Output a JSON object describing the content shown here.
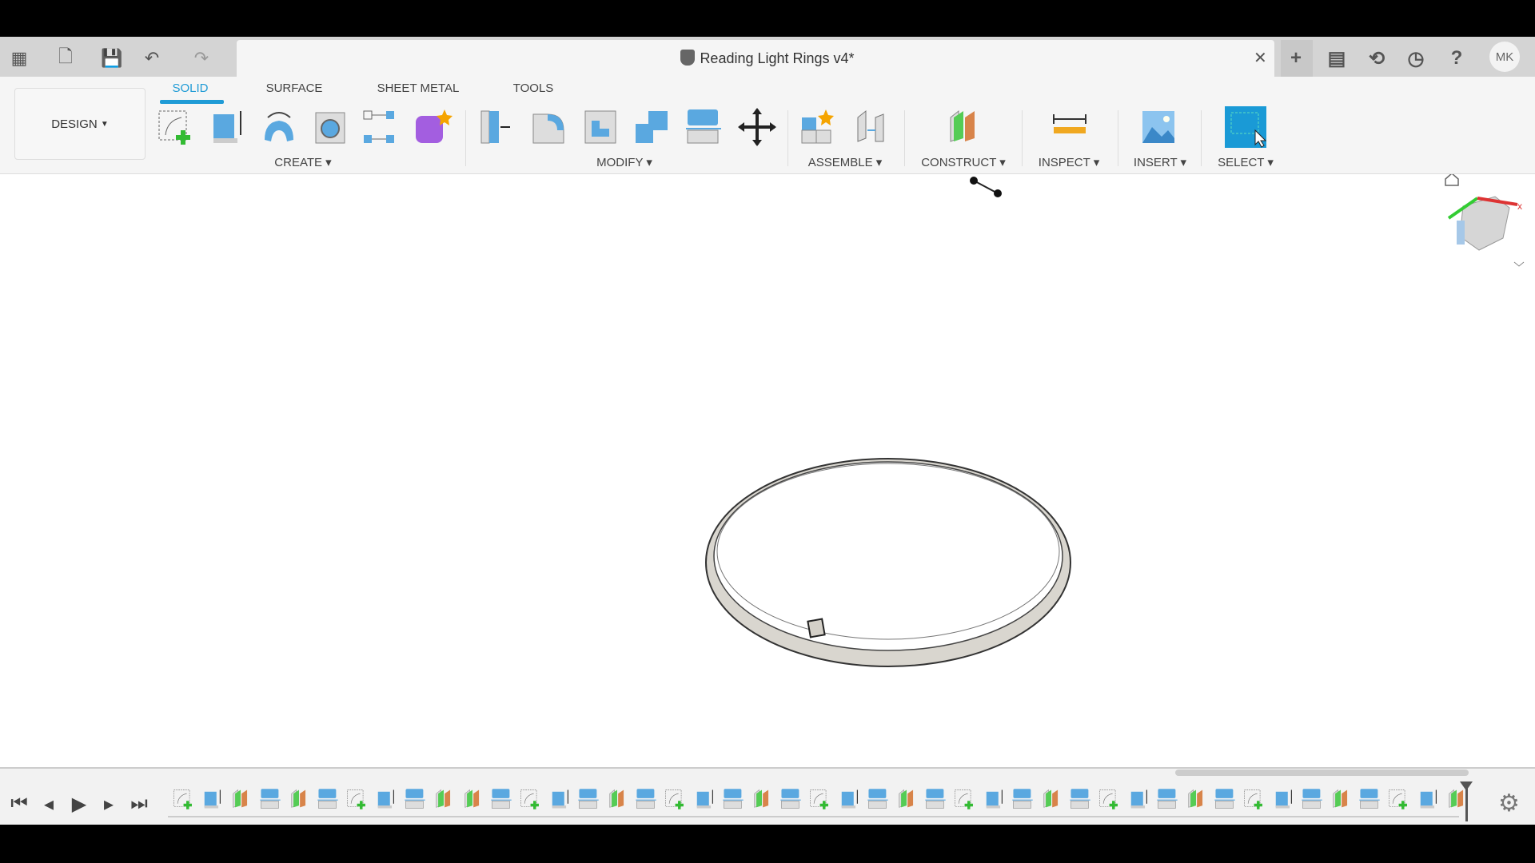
{
  "window": {
    "title": "Reading Light Rings v4*",
    "user_initials": "MK"
  },
  "quick_access": [
    "grid-icon",
    "file-icon",
    "save-icon",
    "undo-icon",
    "redo-icon"
  ],
  "workspace": {
    "label": "DESIGN"
  },
  "tabs": [
    {
      "label": "SOLID",
      "active": true
    },
    {
      "label": "SURFACE"
    },
    {
      "label": "SHEET METAL"
    },
    {
      "label": "TOOLS"
    }
  ],
  "groups": [
    {
      "label": "CREATE ▾",
      "tools": [
        "create-sketch",
        "extrude",
        "revolve",
        "hole",
        "pattern",
        "create-form"
      ]
    },
    {
      "label": "MODIFY ▾",
      "tools": [
        "press-pull",
        "fillet",
        "shell",
        "combine",
        "split-body",
        "move"
      ]
    },
    {
      "label": "ASSEMBLE ▾",
      "tools": [
        "new-component",
        "joint"
      ]
    },
    {
      "label": "CONSTRUCT ▾",
      "tools": [
        "offset-plane"
      ]
    },
    {
      "label": "INSPECT ▾",
      "tools": [
        "measure"
      ]
    },
    {
      "label": "INSERT ▾",
      "tools": [
        "insert-canvas"
      ]
    },
    {
      "label": "SELECT ▾",
      "tools": [
        "select"
      ]
    }
  ],
  "right_icons": [
    "add-tab-icon",
    "comments-icon",
    "extensions-icon",
    "job-status-icon",
    "help-icon"
  ],
  "timeline": {
    "controls": [
      "skip-to-start",
      "step-back",
      "play",
      "step-forward",
      "skip-to-end"
    ],
    "items": [
      "sketch",
      "extrude",
      "plane",
      "split",
      "plane",
      "split",
      "sketch",
      "extrude",
      "split",
      "plane",
      "plane",
      "split",
      "sketch",
      "extrude",
      "split",
      "plane",
      "split",
      "sketch",
      "extrude",
      "split",
      "plane",
      "split",
      "sketch",
      "extrude",
      "split",
      "plane",
      "split",
      "sketch",
      "extrude",
      "split",
      "plane",
      "split",
      "sketch",
      "extrude",
      "split",
      "plane",
      "split",
      "sketch",
      "extrude",
      "split",
      "plane",
      "split",
      "sketch",
      "extrude",
      "plane"
    ]
  },
  "colors": {
    "accent": "#1f9bd6",
    "select_active": "#1a9ad6"
  }
}
